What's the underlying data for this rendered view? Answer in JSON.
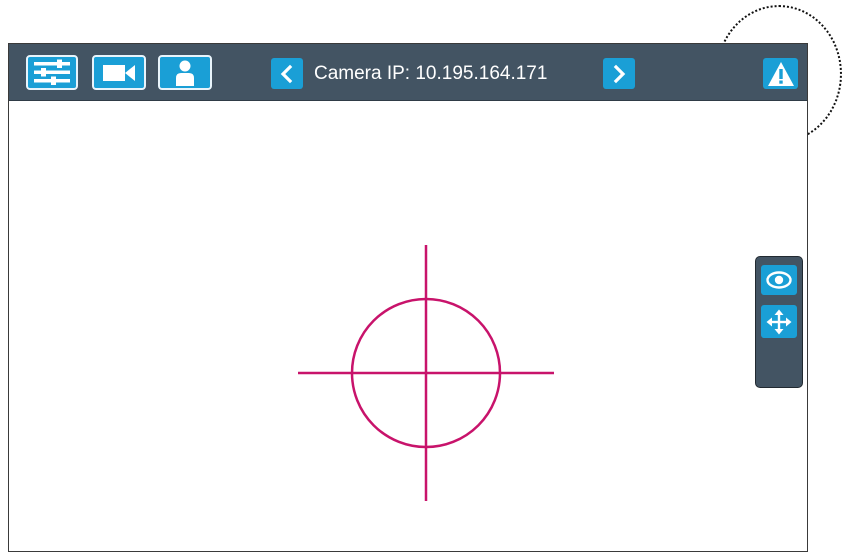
{
  "toolbar": {
    "camera_label": "Camera IP: 10.195.164.171",
    "buttons": [
      {
        "name": "settings",
        "icon": "sliders-icon"
      },
      {
        "name": "camera",
        "icon": "video-camera-icon"
      },
      {
        "name": "user",
        "icon": "user-icon"
      },
      {
        "name": "previous-camera",
        "icon": "chevron-left-icon"
      },
      {
        "name": "next-camera",
        "icon": "chevron-right-icon"
      },
      {
        "name": "alert",
        "icon": "warning-icon"
      }
    ]
  },
  "side_panel": {
    "buttons": [
      {
        "name": "view",
        "icon": "eye-icon"
      },
      {
        "name": "move",
        "icon": "move-arrows-icon"
      }
    ]
  },
  "colors": {
    "toolbar_bg": "#435463",
    "button_accent": "#1a9fd6",
    "crosshair": "#c8136b",
    "frame_border": "#3a3a3a"
  }
}
